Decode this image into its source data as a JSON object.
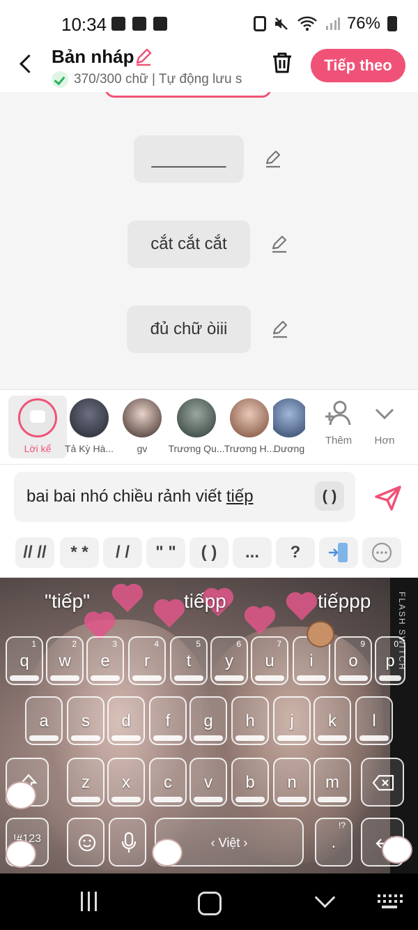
{
  "status_bar": {
    "time": "10:34",
    "battery": "76%"
  },
  "header": {
    "title": "Bản nháp",
    "word_count": "370/300 chữ | Tự động lưu s",
    "next_label": "Tiếp theo"
  },
  "story": {
    "messages": [
      {
        "text": "________"
      },
      {
        "text": "cắt cắt cắt"
      },
      {
        "text": "đủ chữ òiii"
      }
    ]
  },
  "characters": [
    {
      "name": "Lời kể",
      "active": true
    },
    {
      "name": "Tả Kỳ Hà..."
    },
    {
      "name": "gv"
    },
    {
      "name": "Trương Qu..."
    },
    {
      "name": "Trương H..."
    },
    {
      "name": "Dương"
    }
  ],
  "tools": {
    "add_label": "Thêm",
    "more_label": "Hơn"
  },
  "input": {
    "text_before": "bai bai nhó chiều rảnh viết ",
    "text_underlined": "tiếp",
    "paren_label": "( )"
  },
  "format_buttons": [
    "// //",
    "* *",
    "/ /",
    "\" \"",
    "( )",
    "...",
    "?"
  ],
  "keyboard": {
    "suggestions": [
      "\"tiếp\"",
      "tiếpp",
      "tiếppp"
    ],
    "row1": [
      [
        "q",
        "1"
      ],
      [
        "w",
        "2"
      ],
      [
        "e",
        "3"
      ],
      [
        "r",
        "4"
      ],
      [
        "t",
        "5"
      ],
      [
        "y",
        "6"
      ],
      [
        "u",
        "7"
      ],
      [
        "i",
        "8"
      ],
      [
        "o",
        "9"
      ],
      [
        "p",
        "0"
      ]
    ],
    "row2": [
      "a",
      "s",
      "d",
      "f",
      "g",
      "h",
      "j",
      "k",
      "l"
    ],
    "row3": [
      "z",
      "x",
      "c",
      "v",
      "b",
      "n",
      "m"
    ],
    "mode_label": "!#123",
    "space_label": "‹ Việt ›",
    "side_text": "FLASH SWITCH",
    "colors": {
      "heart": "#e0578a",
      "accent": "#f05277"
    }
  }
}
